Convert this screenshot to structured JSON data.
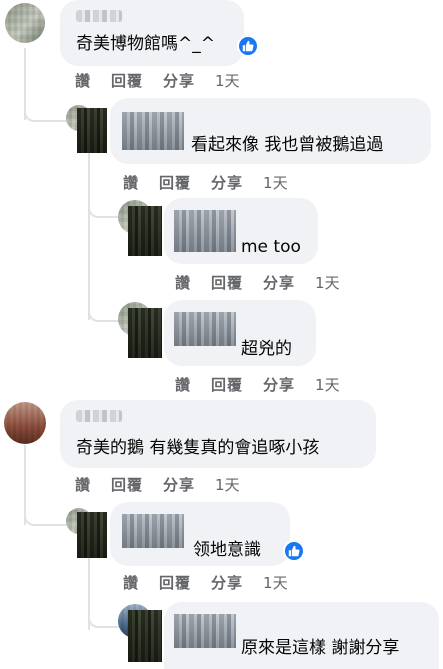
{
  "comments": [
    {
      "text": "奇美博物館嗎^_^",
      "like": "讚",
      "reply": "回覆",
      "share": "分享",
      "time": "1天"
    },
    {
      "text": "看起來像 我也曾被鵝追過",
      "like": "讚",
      "reply": "回覆",
      "share": "分享",
      "time": "1天"
    },
    {
      "text": "me too",
      "like": "讚",
      "reply": "回覆",
      "share": "分享",
      "time": "1天"
    },
    {
      "text": "超兇的",
      "like": "讚",
      "reply": "回覆",
      "share": "分享",
      "time": "1天"
    },
    {
      "text": "奇美的鵝 有幾隻真的會追啄小孩",
      "like": "讚",
      "reply": "回覆",
      "share": "分享",
      "time": "1天"
    },
    {
      "text": "领地意識",
      "like": "讚",
      "reply": "回覆",
      "share": "分享",
      "time": "1天"
    },
    {
      "text": "原來是這樣 謝謝分享"
    }
  ],
  "reaction_color": "#1877f2",
  "reaction_icon": "thumbs-up-icon"
}
